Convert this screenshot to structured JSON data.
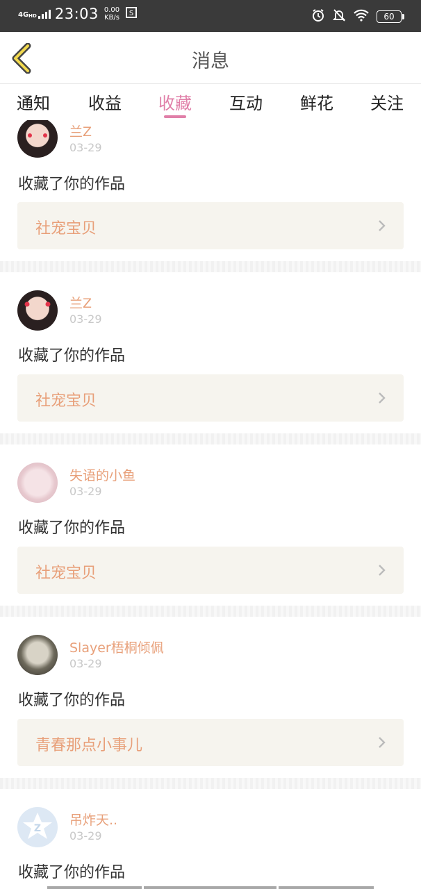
{
  "status_bar": {
    "network": "4G",
    "network_sup": "HD",
    "time": "23:03",
    "speed_value": "0.00",
    "speed_unit": "KB/s",
    "battery": "60"
  },
  "header": {
    "title": "消息"
  },
  "tabs": [
    {
      "label": "通知"
    },
    {
      "label": "收益"
    },
    {
      "label": "收藏"
    },
    {
      "label": "互动"
    },
    {
      "label": "鲜花"
    },
    {
      "label": "关注"
    }
  ],
  "active_tab": "收藏",
  "items": [
    {
      "user": "兰Z",
      "date": "03-29",
      "action": "收藏了你的作品",
      "work": "社宠宝贝"
    },
    {
      "user": "兰Z",
      "date": "03-29",
      "action": "收藏了你的作品",
      "work": "社宠宝贝"
    },
    {
      "user": "失语的小鱼",
      "date": "03-29",
      "action": "收藏了你的作品",
      "work": "社宠宝贝"
    },
    {
      "user": "Slayer梧桐倾佩",
      "date": "03-29",
      "action": "收藏了你的作品",
      "work": "青春那点小事儿"
    },
    {
      "user": "吊炸天..",
      "date": "03-29",
      "action": "收藏了你的作品",
      "work": ""
    }
  ],
  "colors": {
    "accent_pink": "#e07fa8",
    "username_orange": "#e8a07a",
    "card_bg": "#f6f4ee",
    "status_bar": "#3a3a3a"
  }
}
